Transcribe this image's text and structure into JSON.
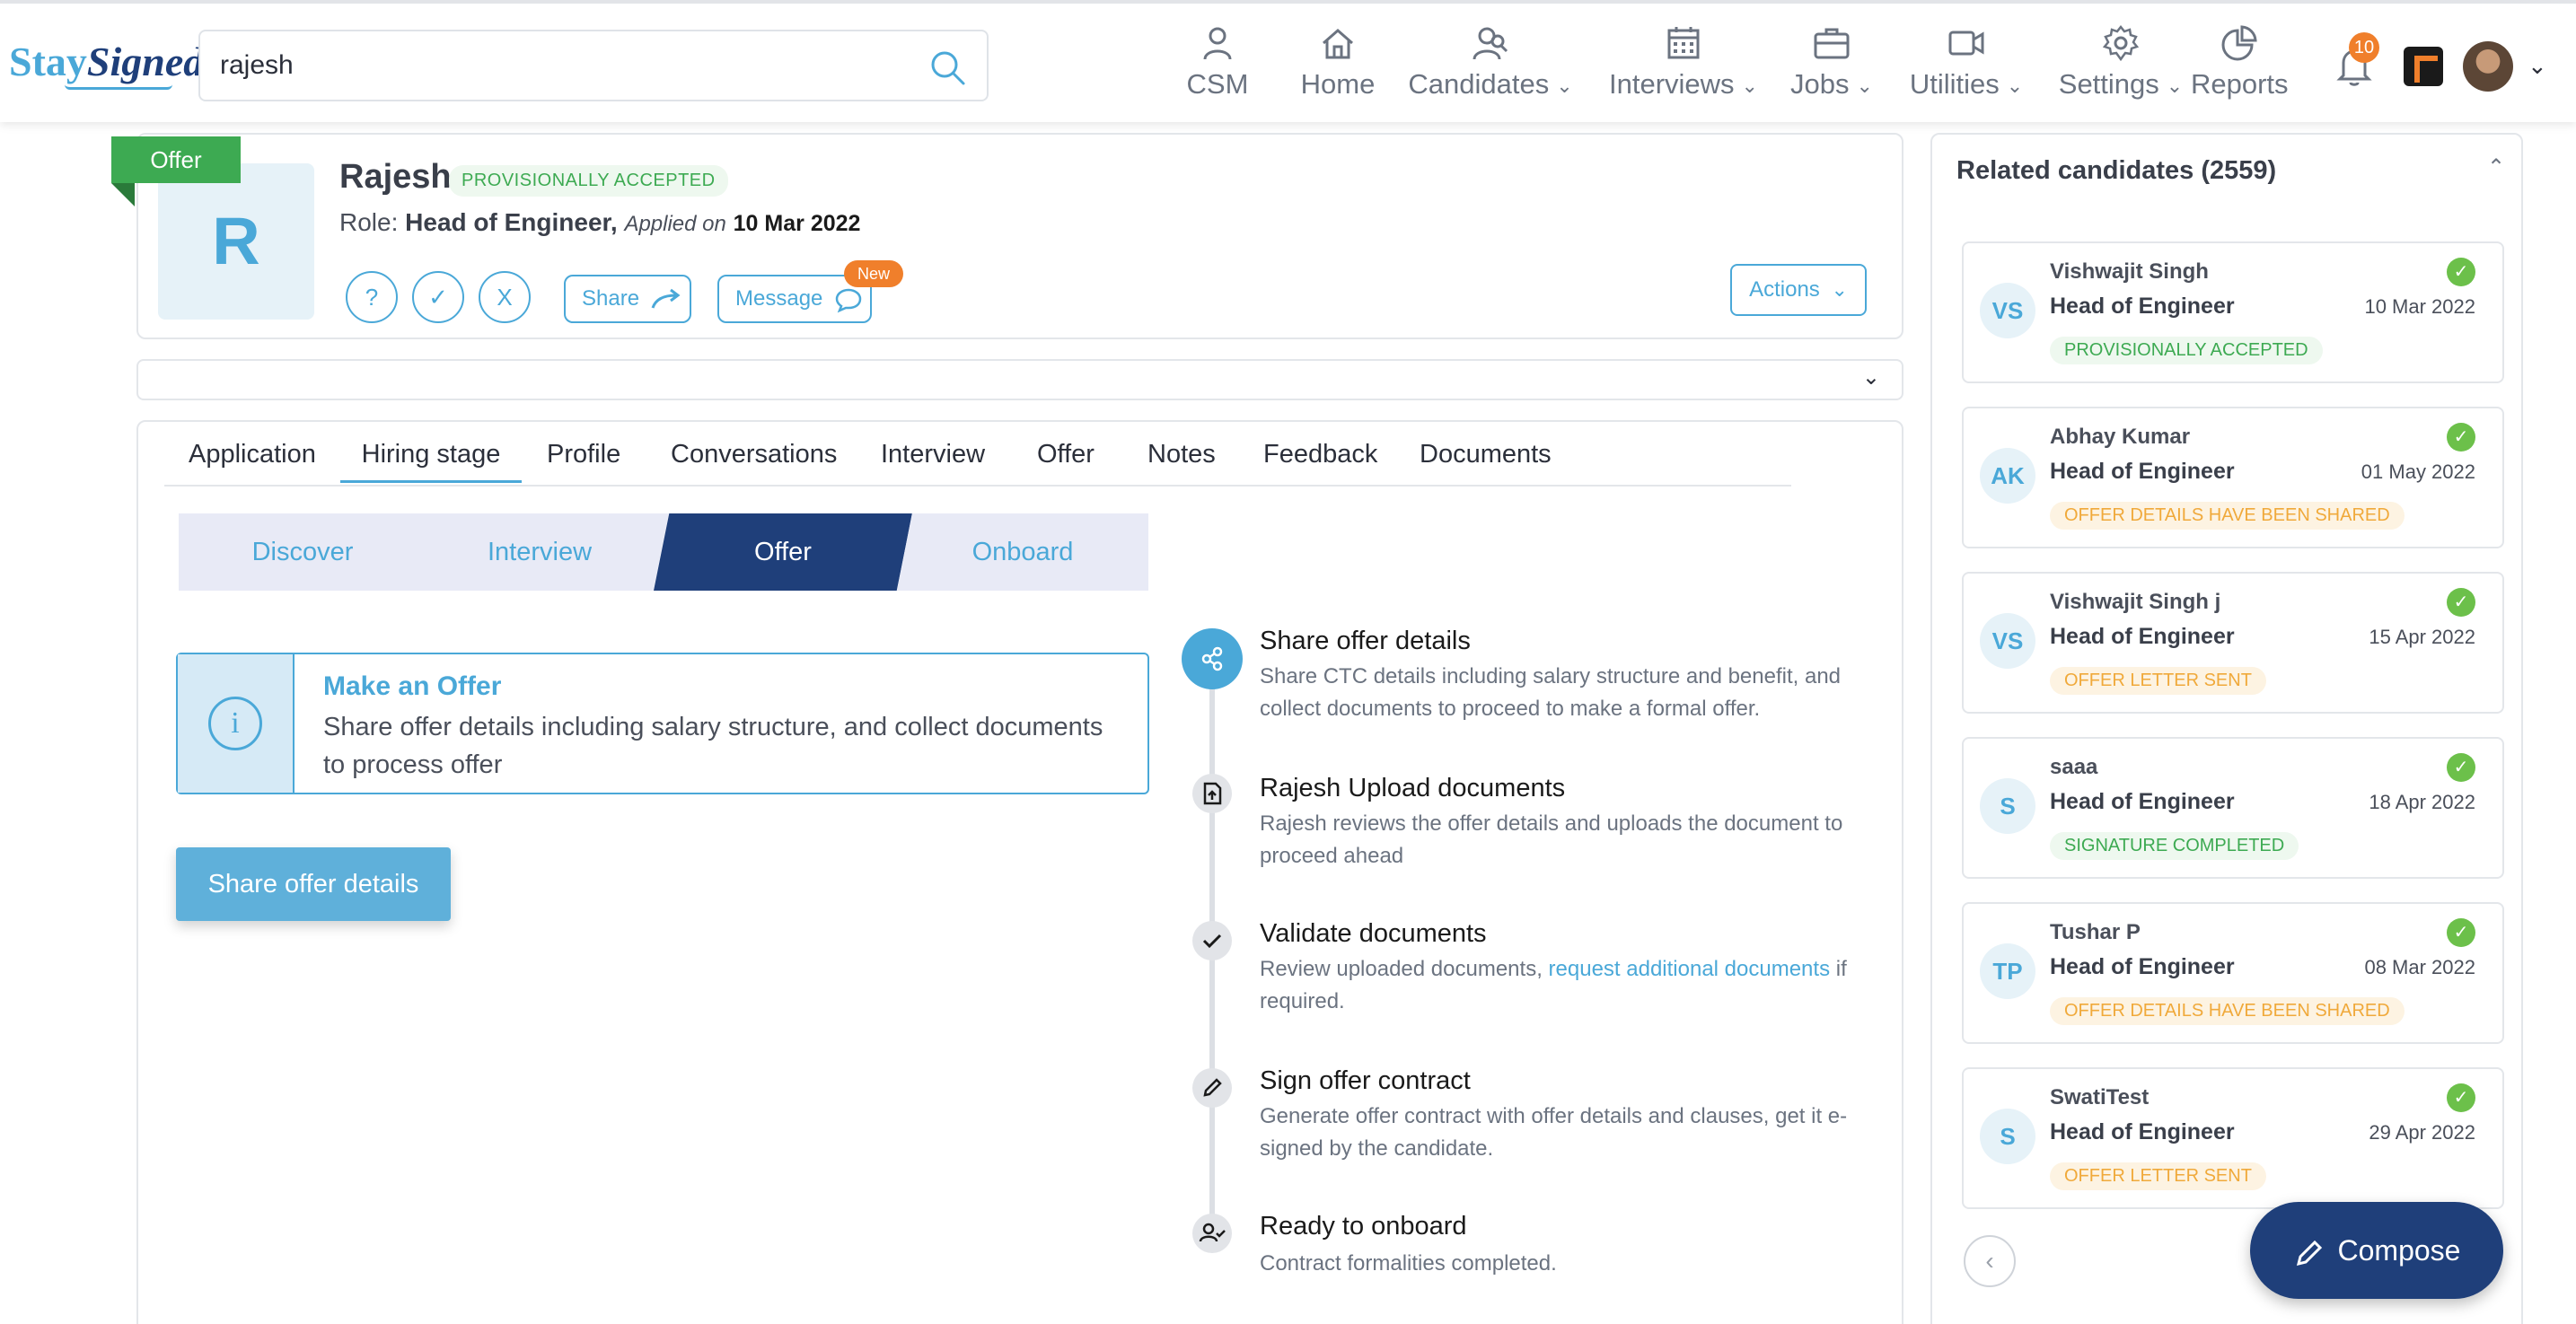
{
  "brand": {
    "logo_part1": "Stay",
    "logo_part2": "Signed"
  },
  "search": {
    "value": "rajesh"
  },
  "nav": {
    "csm": "CSM",
    "home": "Home",
    "candidates": "Candidates",
    "interviews": "Interviews",
    "jobs": "Jobs",
    "utilities": "Utilities",
    "settings": "Settings",
    "reports": "Reports",
    "notifications_count": "10"
  },
  "candidate": {
    "flag": "Offer",
    "initial": "R",
    "name": "Rajesh",
    "status": "PROVISIONALLY ACCEPTED",
    "role_prefix": "Role: ",
    "role": "Head of Engineer,",
    "applied_label": "Applied  on",
    "applied_date": "10 Mar 2022",
    "btn_question": "?",
    "btn_check": "✓",
    "btn_x": "X",
    "share_label": "Share",
    "message_label": "Message",
    "new_badge": "New",
    "actions_label": "Actions"
  },
  "tabs": [
    "Application",
    "Hiring stage",
    "Profile",
    "Conversations",
    "Interview",
    "Offer",
    "Notes",
    "Feedback",
    "Documents"
  ],
  "stages": [
    "Discover",
    "Interview",
    "Offer",
    "Onboard"
  ],
  "offer_info": {
    "icon": "i",
    "title": "Make an Offer",
    "text": "Share offer details including salary structure, and collect documents to process offer"
  },
  "share_offer_button": "Share offer details",
  "timeline": [
    {
      "title": "Share offer details",
      "desc": "Share CTC details including salary structure and benefit, and collect documents to proceed to make a formal offer."
    },
    {
      "title": "Rajesh Upload documents",
      "desc": "Rajesh reviews the offer details and uploads the document to proceed ahead"
    },
    {
      "title": "Validate documents",
      "desc_before": "Review uploaded documents, ",
      "desc_link": "request additional documents",
      "desc_after": " if required."
    },
    {
      "title": "Sign offer contract",
      "desc": "Generate offer contract with offer details and clauses, get it e-signed by the candidate."
    },
    {
      "title": "Ready to onboard",
      "desc": "Contract formalities completed."
    }
  ],
  "related": {
    "title": "Related candidates (2559)",
    "items": [
      {
        "initials": "VS",
        "name": "Vishwajit Singh",
        "role": "Head of Engineer",
        "date": "10 Mar 2022",
        "status": "PROVISIONALLY ACCEPTED",
        "tone": "green"
      },
      {
        "initials": "AK",
        "name": "Abhay Kumar",
        "role": "Head of Engineer",
        "date": "01 May 2022",
        "status": "OFFER DETAILS HAVE BEEN SHARED",
        "tone": "orange"
      },
      {
        "initials": "VS",
        "name": "Vishwajit Singh j",
        "role": "Head of Engineer",
        "date": "15 Apr 2022",
        "status": "OFFER LETTER SENT",
        "tone": "orange"
      },
      {
        "initials": "S",
        "name": "saaa",
        "role": "Head of Engineer",
        "date": "18 Apr 2022",
        "status": "SIGNATURE COMPLETED",
        "tone": "green"
      },
      {
        "initials": "TP",
        "name": "Tushar P",
        "role": "Head of Engineer",
        "date": "08 Mar 2022",
        "status": "OFFER DETAILS HAVE BEEN SHARED",
        "tone": "orange"
      },
      {
        "initials": "S",
        "name": "SwatiTest",
        "role": "Head of Engineer",
        "date": "29 Apr 2022",
        "status": "OFFER LETTER SENT",
        "tone": "orange"
      }
    ]
  },
  "compose_label": "Compose",
  "colors": {
    "accent": "#4aa8d8",
    "navy": "#1f3f7a",
    "success": "#3daa52",
    "warning": "#f07f2b"
  }
}
